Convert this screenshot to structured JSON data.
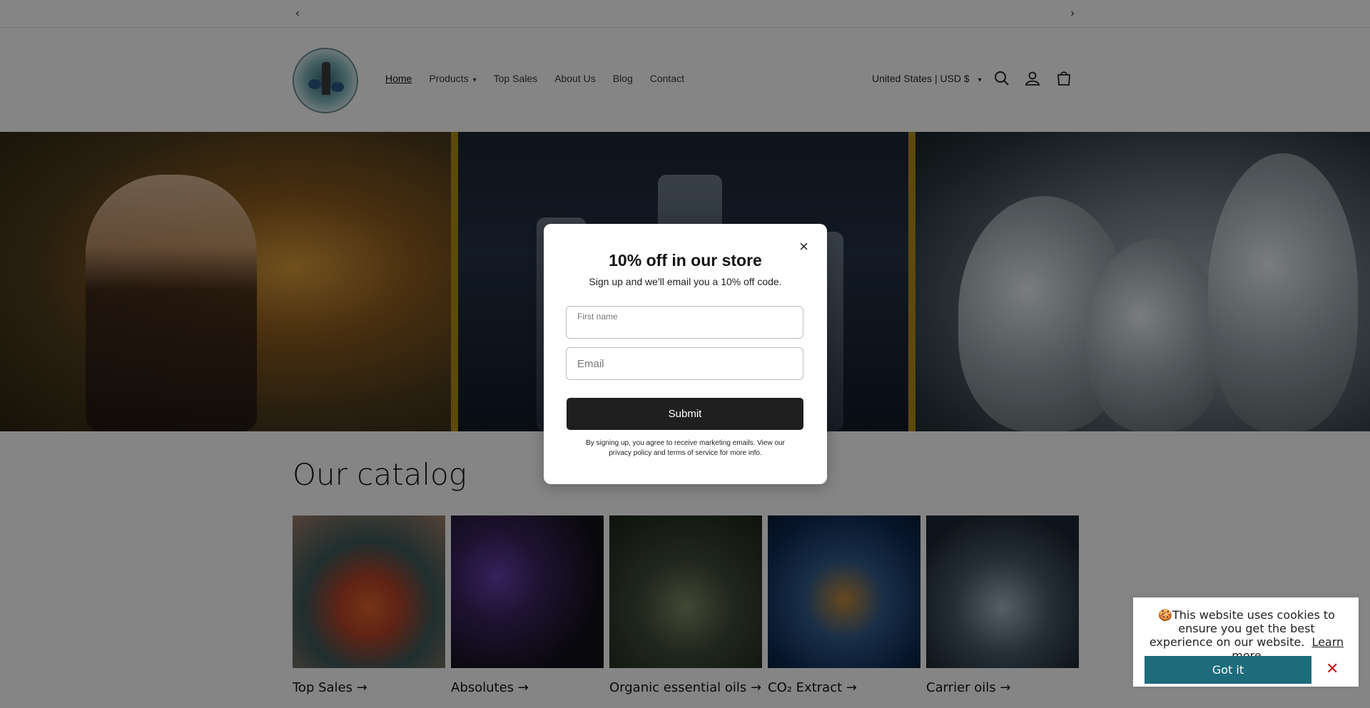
{
  "announcement": {
    "prev": "‹",
    "next": "›"
  },
  "header": {
    "nav": [
      {
        "label": "Home"
      },
      {
        "label": "Products"
      },
      {
        "label": "Top Sales"
      },
      {
        "label": "About Us"
      },
      {
        "label": "Blog"
      },
      {
        "label": "Contact"
      }
    ],
    "country_selector": "United States | USD $",
    "icons": [
      "search-icon",
      "account-icon",
      "cart-icon"
    ]
  },
  "catalog": {
    "title": "Our catalog",
    "items": [
      {
        "label": "Top Sales →"
      },
      {
        "label": "Absolutes →"
      },
      {
        "label": "Organic essential oils →"
      },
      {
        "label": "CO₂ Extract →"
      },
      {
        "label": "Carrier oils →"
      }
    ]
  },
  "popup": {
    "close": "×",
    "title": "10% off in our store",
    "subtitle": "Sign up and we'll email you a 10% off code.",
    "first_name_placeholder": "First name",
    "email_placeholder": "Email",
    "submit": "Submit",
    "legal": "By signing up, you agree to receive marketing emails. View our privacy policy and terms of service for more info."
  },
  "cookie": {
    "emoji": "🍪",
    "message": "This website uses cookies to ensure you get the best experience on our website.",
    "learn_more": "Learn more",
    "accept": "Got it",
    "dismiss": "✕",
    "accent_color": "#1d6b7b"
  }
}
